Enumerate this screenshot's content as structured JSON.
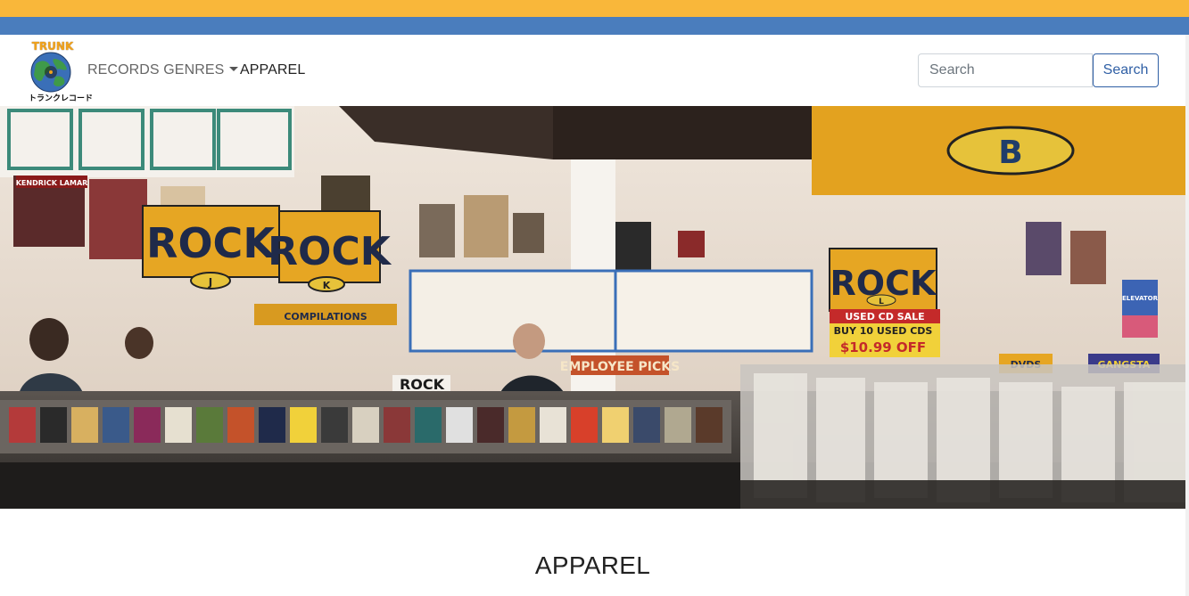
{
  "brand": {
    "logo_text": "TRUNK",
    "logo_subtext": "トランクレコード",
    "colors": {
      "stripe_top": "#f9b73a",
      "stripe_bottom": "#4a7dbd",
      "accent": "#2f5fa5"
    }
  },
  "nav": {
    "genres_label": "RECORDS GENRES",
    "apparel_label": "APPAREL"
  },
  "search": {
    "placeholder": "Search",
    "button_label": "Search"
  },
  "hero": {
    "image": "record-store-interior-photo",
    "sign_rock_1": "ROCK",
    "sign_rock_1_letter": "J",
    "sign_rock_2": "ROCK",
    "sign_rock_2_letter": "K",
    "sign_rock_3": "ROCK",
    "sign_rock_3_letter": "L",
    "sign_b_letter": "B",
    "sign_compilations": "COMPILATIONS",
    "sign_used_cd": "USED CD SALE",
    "sign_buy_10": "BUY 10 USED CDS",
    "sign_price": "$10.99 OFF",
    "sign_employee_picks": "EMPLOYEE PICKS",
    "sign_rock_bin": "ROCK",
    "sign_elevator": "ELEVATOR",
    "sign_kendrick": "KENDRICK LAMAR",
    "sign_dvds": "DVDS",
    "sign_gangster": "GANGSTA"
  },
  "main": {
    "title": "APPAREL"
  }
}
